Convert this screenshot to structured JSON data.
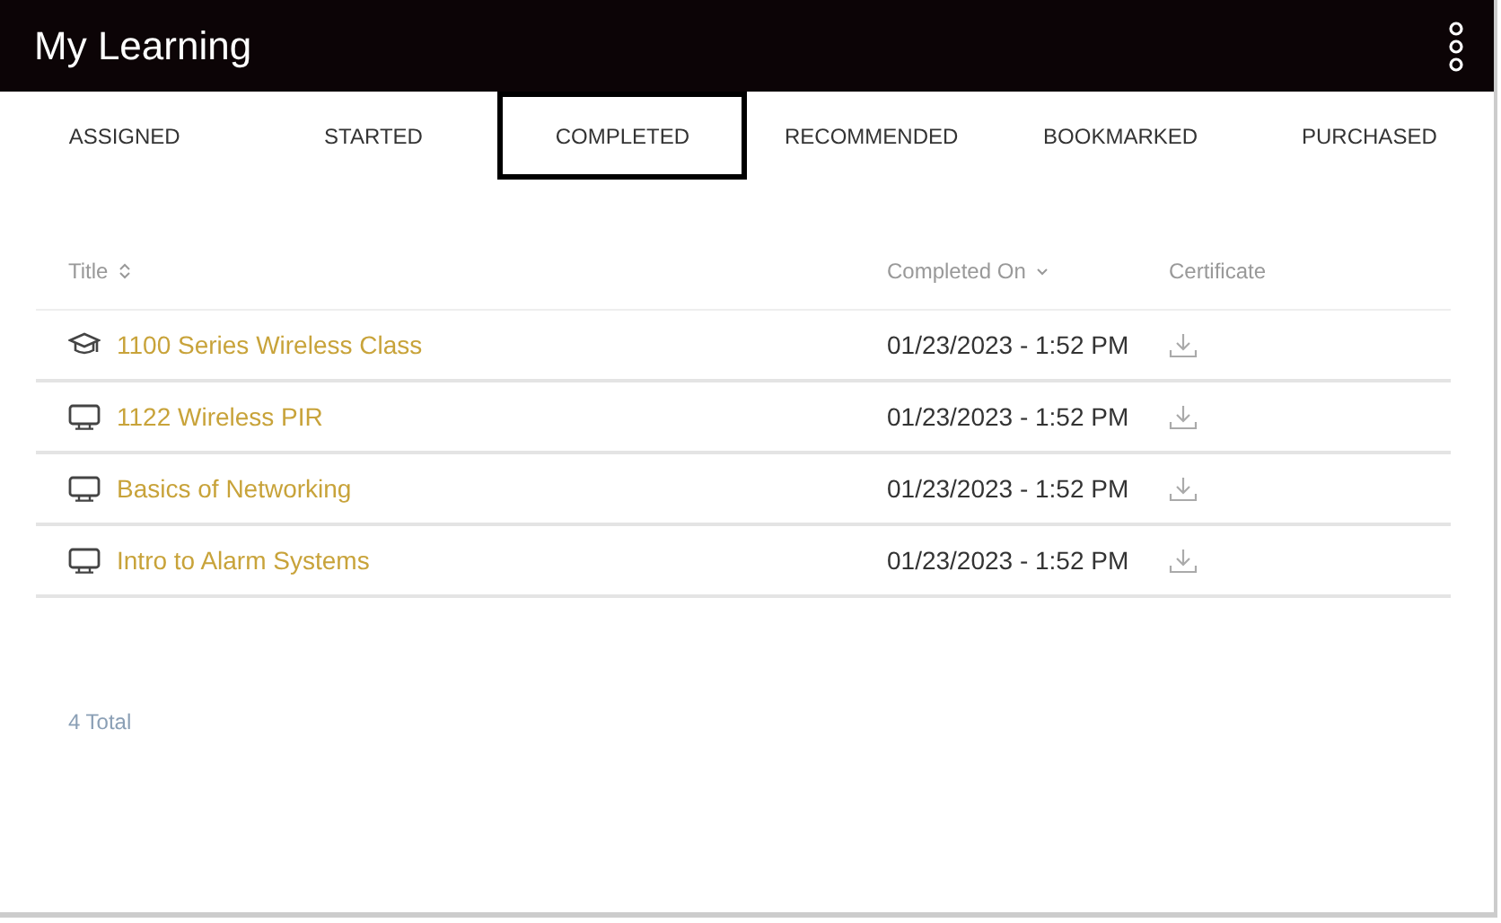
{
  "header": {
    "title": "My Learning"
  },
  "tabs": [
    {
      "label": "ASSIGNED",
      "selected": false
    },
    {
      "label": "STARTED",
      "selected": false
    },
    {
      "label": "COMPLETED",
      "selected": true
    },
    {
      "label": "RECOMMENDED",
      "selected": false
    },
    {
      "label": "BOOKMARKED",
      "selected": false
    },
    {
      "label": "PURCHASED",
      "selected": false
    }
  ],
  "table": {
    "columns": [
      {
        "label": "Title",
        "kind": "sortable"
      },
      {
        "label": "Completed On",
        "kind": "sorted"
      },
      {
        "label": "Certificate",
        "kind": "plain"
      }
    ],
    "rows": [
      {
        "kind": "class",
        "title": "1100 Series Wireless Class",
        "completed_on": "01/23/2023 - 1:52 PM"
      },
      {
        "kind": "online",
        "title": "1122 Wireless PIR",
        "completed_on": "01/23/2023 - 1:52 PM"
      },
      {
        "kind": "online",
        "title": "Basics of Networking",
        "completed_on": "01/23/2023 - 1:52 PM"
      },
      {
        "kind": "online",
        "title": "Intro to Alarm Systems",
        "completed_on": "01/23/2023 - 1:52 PM"
      }
    ]
  },
  "total": {
    "count": "4",
    "label": "Total"
  }
}
